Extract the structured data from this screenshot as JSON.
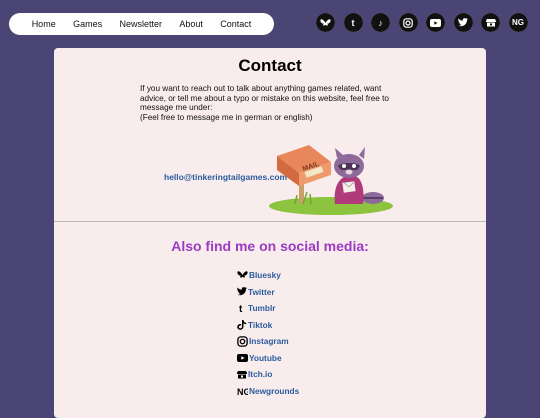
{
  "nav": {
    "home": "Home",
    "games": "Games",
    "newsletter": "Newsletter",
    "about": "About",
    "contact": "Contact"
  },
  "header_social_icons": [
    "bluesky-icon",
    "tumblr-icon",
    "tiktok-icon",
    "instagram-icon",
    "youtube-icon",
    "twitter-icon",
    "itchio-icon",
    "newgrounds-icon"
  ],
  "page": {
    "title": "Contact",
    "intro_line1": "If you want to reach out to talk about anything games related, want advice, or tell me about a typo or mistake on this website, feel free to message me under:",
    "intro_line2": "(Feel free to message me in german or english)",
    "email": "hello@tinkeringtailgames.com",
    "mailbox_label": "MAIL",
    "social_title": "Also find me on social media:"
  },
  "social_links": [
    {
      "label": "Bluesky"
    },
    {
      "label": "Twitter"
    },
    {
      "label": "Tumblr"
    },
    {
      "label": "Tiktok"
    },
    {
      "label": "Instagram"
    },
    {
      "label": "Youtube"
    },
    {
      "label": "Itch.io"
    },
    {
      "label": "Newgrounds"
    }
  ],
  "colors": {
    "background": "#4b4575",
    "card": "#f9ecec",
    "link": "#2a5c9e",
    "heading_accent": "#9b3bc4"
  }
}
